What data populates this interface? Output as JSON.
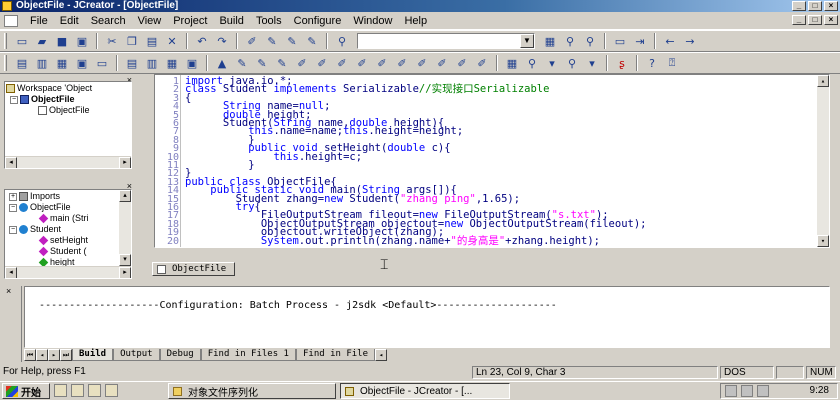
{
  "window": {
    "title": "ObjectFile - JCreator - [ObjectFile]",
    "controls": [
      "_",
      "□",
      "×"
    ]
  },
  "menu": [
    "File",
    "Edit",
    "Search",
    "View",
    "Project",
    "Build",
    "Tools",
    "Configure",
    "Window",
    "Help"
  ],
  "workspace": {
    "header_label": "Workspace 'Object",
    "project": "ObjectFile",
    "file": "ObjectFile"
  },
  "classview": {
    "imports": "Imports",
    "class1": "ObjectFile",
    "class1_member": "main (Stri",
    "class2": "Student",
    "class2_members": [
      "setHeight",
      "Student (",
      "height"
    ]
  },
  "editor": {
    "lines": [
      {
        "n": "1",
        "html": "<span class=\"kw\">import</span> java.io.*;"
      },
      {
        "n": "2",
        "html": "<span class=\"kw\">class</span> Student <span class=\"kw\">implements</span> Serializable<span class=\"cmt\">//实现接口Serializable</span>"
      },
      {
        "n": "3",
        "html": "{"
      },
      {
        "n": "4",
        "html": "      <span class=\"kw\">String</span> name=<span class=\"kw\">null</span>;"
      },
      {
        "n": "5",
        "html": "      <span class=\"kw\">double</span> height;"
      },
      {
        "n": "6",
        "html": "      Student(<span class=\"kw\">String</span> name,<span class=\"kw\">double</span> height){"
      },
      {
        "n": "7",
        "html": "          <span class=\"kw\">this</span>.name=name;<span class=\"kw\">this</span>.height=height;"
      },
      {
        "n": "8",
        "html": "          }"
      },
      {
        "n": "9",
        "html": "          <span class=\"kw\">public void</span> setHeight(<span class=\"kw\">double</span> c){"
      },
      {
        "n": "10",
        "html": "              <span class=\"kw\">this</span>.height=c;"
      },
      {
        "n": "11",
        "html": "          }"
      },
      {
        "n": "12",
        "html": "}"
      },
      {
        "n": "13",
        "html": "<span class=\"kw\">public class</span> ObjectFile{"
      },
      {
        "n": "14",
        "html": "    <span class=\"kw\">public static void</span> main(<span class=\"kw\">String</span> args[]){"
      },
      {
        "n": "15",
        "html": "        Student zhang=<span class=\"kw\">new</span> Student(<span class=\"str\">\"zhang ping\"</span>,1.65);"
      },
      {
        "n": "16",
        "html": "        <span class=\"kw\">try</span>{"
      },
      {
        "n": "17",
        "html": "            FileOutputStream fileout=<span class=\"kw\">new</span> FileOutputStream(<span class=\"str\">\"s.txt\"</span>);"
      },
      {
        "n": "18",
        "html": "            ObjectOutputStream objectout=<span class=\"kw\">new</span> ObjectOutputStream(fileout);"
      },
      {
        "n": "19",
        "html": "            objectout.writeObject(zhang);"
      },
      {
        "n": "20",
        "html": "            <span class=\"kw\">System</span>.out.println(zhang.name+<span class=\"str\">\"的身高是\"</span>+zhang.height);"
      }
    ],
    "tab_label": "ObjectFile"
  },
  "output": {
    "text": "--------------------Configuration: Batch Process - j2sdk <Default>--------------------",
    "tabs": [
      "Build",
      "Output",
      "Debug",
      "Find in Files 1",
      "Find in File"
    ]
  },
  "status": {
    "help": "For Help, press F1",
    "position": "Ln 23, Col 9, Char 3",
    "dos": "DOS",
    "num": "NUM"
  },
  "taskbar": {
    "start": "开始",
    "task1": "对象文件序列化",
    "task2": "ObjectFile - JCreator - [...",
    "clock": "9:28"
  }
}
